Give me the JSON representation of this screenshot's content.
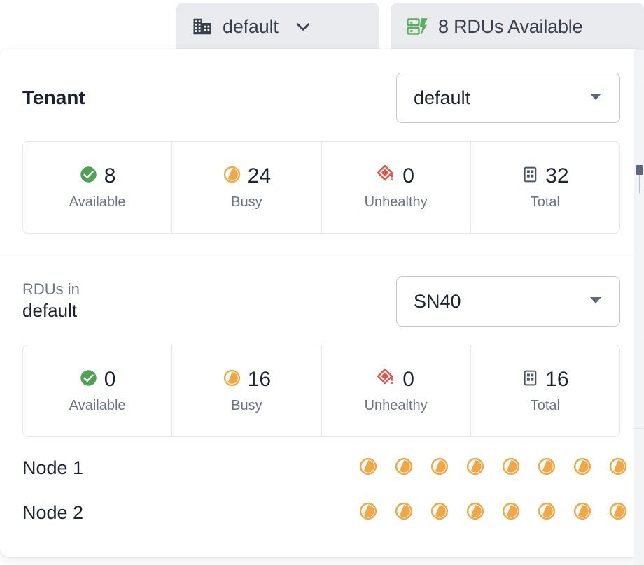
{
  "tabs": [
    {
      "id": "tenant",
      "icon": "building-icon",
      "label": "default",
      "chevron": "chevron-down-icon"
    },
    {
      "id": "rdus",
      "icon": "server-bolt-icon",
      "label": "8 RDUs Available"
    }
  ],
  "colors": {
    "available": "#4fa254",
    "busy": "#efa845",
    "unhealthy": "#e0564c",
    "total": "#4a5568",
    "tab_bg": "#e9ebef",
    "text_dark": "#1b2333",
    "text_muted": "#6b7487",
    "accent_green": "#5cab5f"
  },
  "tenant_section": {
    "title": "Tenant",
    "select": {
      "value": "default",
      "placeholder": "default",
      "chevron": "chevron-down-icon"
    },
    "stats": [
      {
        "icon": "check-circle-icon",
        "value": "8",
        "label": "Available"
      },
      {
        "icon": "busy-clock-icon",
        "value": "24",
        "label": "Busy"
      },
      {
        "icon": "diamond-alert-icon",
        "value": "0",
        "label": "Unhealthy"
      },
      {
        "icon": "grid-icon",
        "value": "32",
        "label": "Total"
      }
    ]
  },
  "rdus_section": {
    "title_prefix": "RDUs in",
    "title_name": "default",
    "select": {
      "value": "SN40",
      "placeholder": "SN40",
      "chevron": "chevron-down-icon"
    },
    "stats": [
      {
        "icon": "check-circle-icon",
        "value": "0",
        "label": "Available"
      },
      {
        "icon": "busy-clock-icon",
        "value": "16",
        "label": "Busy"
      },
      {
        "icon": "diamond-alert-icon",
        "value": "0",
        "label": "Unhealthy"
      },
      {
        "icon": "grid-icon",
        "value": "16",
        "label": "Total"
      }
    ],
    "nodes": [
      {
        "name": "Node 1",
        "rdu_states": [
          "busy",
          "busy",
          "busy",
          "busy",
          "busy",
          "busy",
          "busy",
          "busy"
        ]
      },
      {
        "name": "Node 2",
        "rdu_states": [
          "busy",
          "busy",
          "busy",
          "busy",
          "busy",
          "busy",
          "busy",
          "busy"
        ]
      }
    ]
  },
  "scrollbar": {
    "orientation": "vertical"
  }
}
